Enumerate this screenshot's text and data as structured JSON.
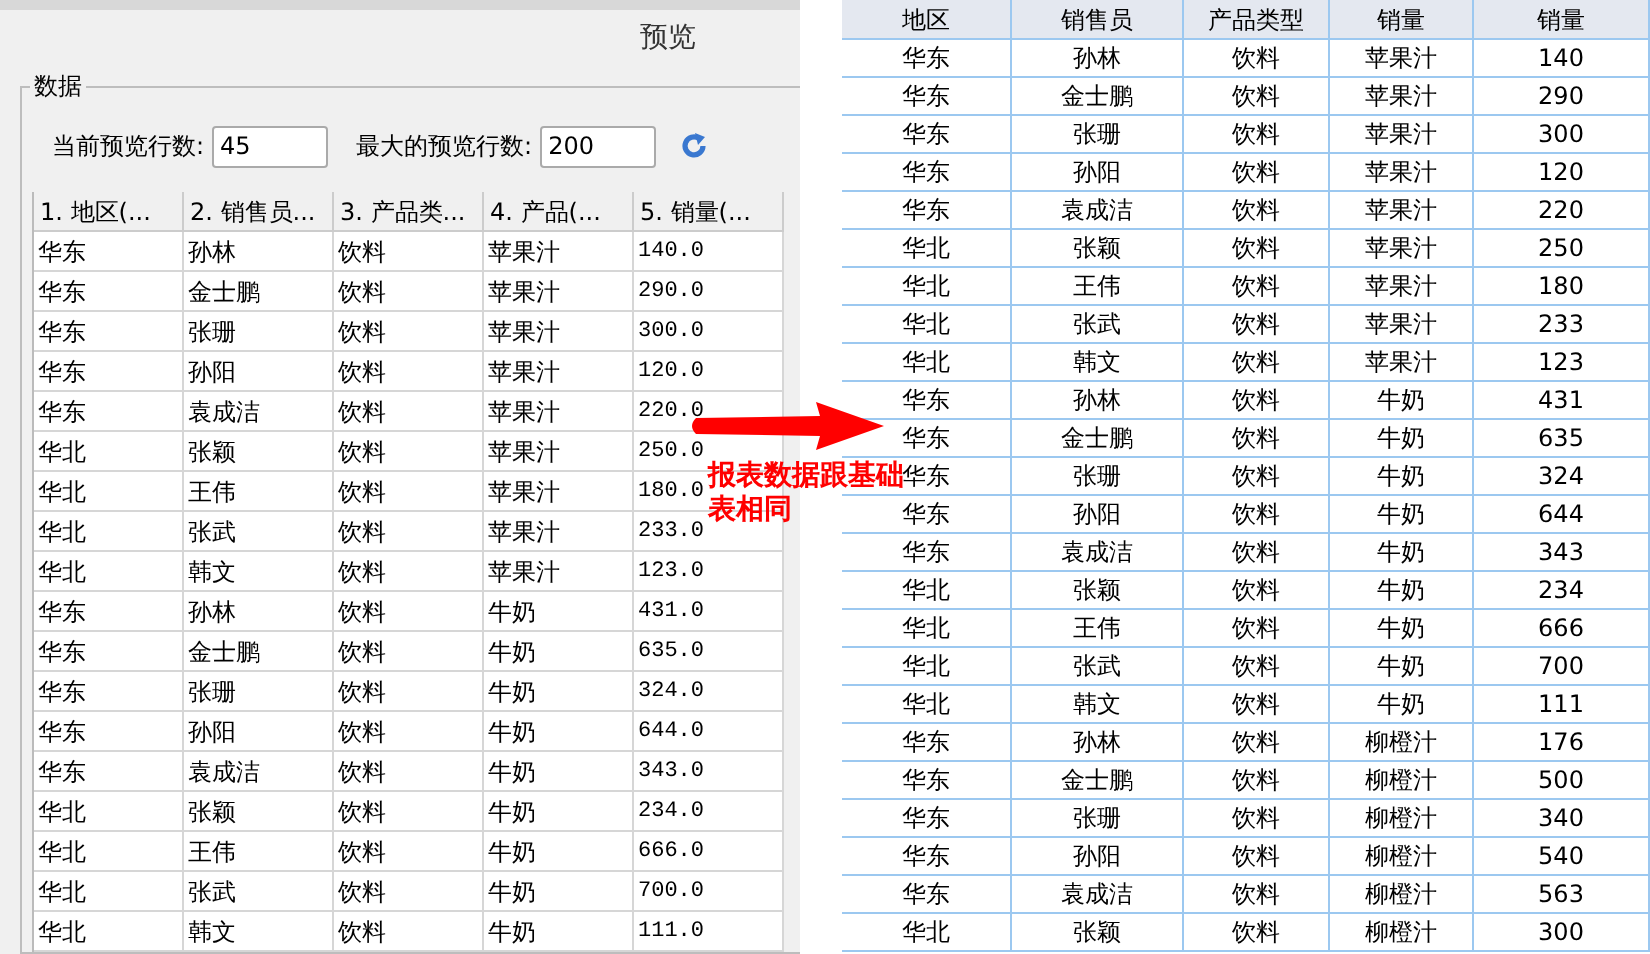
{
  "preview": {
    "title": "预览",
    "group_label": "数据",
    "current_rows": {
      "label": "当前预览行数:",
      "value": "45"
    },
    "max_rows": {
      "label": "最大的预览行数:",
      "value": "200"
    },
    "columns": [
      "1. 地区(...",
      "2. 销售员...",
      "3. 产品类...",
      "4. 产品(...",
      "5. 销量(..."
    ],
    "rows": [
      [
        "华东",
        "孙林",
        "饮料",
        "苹果汁",
        "140.0"
      ],
      [
        "华东",
        "金士鹏",
        "饮料",
        "苹果汁",
        "290.0"
      ],
      [
        "华东",
        "张珊",
        "饮料",
        "苹果汁",
        "300.0"
      ],
      [
        "华东",
        "孙阳",
        "饮料",
        "苹果汁",
        "120.0"
      ],
      [
        "华东",
        "袁成洁",
        "饮料",
        "苹果汁",
        "220.0"
      ],
      [
        "华北",
        "张颖",
        "饮料",
        "苹果汁",
        "250.0"
      ],
      [
        "华北",
        "王伟",
        "饮料",
        "苹果汁",
        "180.0"
      ],
      [
        "华北",
        "张武",
        "饮料",
        "苹果汁",
        "233.0"
      ],
      [
        "华北",
        "韩文",
        "饮料",
        "苹果汁",
        "123.0"
      ],
      [
        "华东",
        "孙林",
        "饮料",
        "牛奶",
        "431.0"
      ],
      [
        "华东",
        "金士鹏",
        "饮料",
        "牛奶",
        "635.0"
      ],
      [
        "华东",
        "张珊",
        "饮料",
        "牛奶",
        "324.0"
      ],
      [
        "华东",
        "孙阳",
        "饮料",
        "牛奶",
        "644.0"
      ],
      [
        "华东",
        "袁成洁",
        "饮料",
        "牛奶",
        "343.0"
      ],
      [
        "华北",
        "张颖",
        "饮料",
        "牛奶",
        "234.0"
      ],
      [
        "华北",
        "王伟",
        "饮料",
        "牛奶",
        "666.0"
      ],
      [
        "华北",
        "张武",
        "饮料",
        "牛奶",
        "700.0"
      ],
      [
        "华北",
        "韩文",
        "饮料",
        "牛奶",
        "111.0"
      ]
    ]
  },
  "annotation": "报表数据跟基础表相同",
  "report": {
    "columns": [
      "地区",
      "销售员",
      "产品类型",
      "销量",
      "销量"
    ],
    "rows": [
      [
        "华东",
        "孙林",
        "饮料",
        "苹果汁",
        "140"
      ],
      [
        "华东",
        "金士鹏",
        "饮料",
        "苹果汁",
        "290"
      ],
      [
        "华东",
        "张珊",
        "饮料",
        "苹果汁",
        "300"
      ],
      [
        "华东",
        "孙阳",
        "饮料",
        "苹果汁",
        "120"
      ],
      [
        "华东",
        "袁成洁",
        "饮料",
        "苹果汁",
        "220"
      ],
      [
        "华北",
        "张颖",
        "饮料",
        "苹果汁",
        "250"
      ],
      [
        "华北",
        "王伟",
        "饮料",
        "苹果汁",
        "180"
      ],
      [
        "华北",
        "张武",
        "饮料",
        "苹果汁",
        "233"
      ],
      [
        "华北",
        "韩文",
        "饮料",
        "苹果汁",
        "123"
      ],
      [
        "华东",
        "孙林",
        "饮料",
        "牛奶",
        "431"
      ],
      [
        "华东",
        "金士鹏",
        "饮料",
        "牛奶",
        "635"
      ],
      [
        "华东",
        "张珊",
        "饮料",
        "牛奶",
        "324"
      ],
      [
        "华东",
        "孙阳",
        "饮料",
        "牛奶",
        "644"
      ],
      [
        "华东",
        "袁成洁",
        "饮料",
        "牛奶",
        "343"
      ],
      [
        "华北",
        "张颖",
        "饮料",
        "牛奶",
        "234"
      ],
      [
        "华北",
        "王伟",
        "饮料",
        "牛奶",
        "666"
      ],
      [
        "华北",
        "张武",
        "饮料",
        "牛奶",
        "700"
      ],
      [
        "华北",
        "韩文",
        "饮料",
        "牛奶",
        "111"
      ],
      [
        "华东",
        "孙林",
        "饮料",
        "柳橙汁",
        "176"
      ],
      [
        "华东",
        "金士鹏",
        "饮料",
        "柳橙汁",
        "500"
      ],
      [
        "华东",
        "张珊",
        "饮料",
        "柳橙汁",
        "340"
      ],
      [
        "华东",
        "孙阳",
        "饮料",
        "柳橙汁",
        "540"
      ],
      [
        "华东",
        "袁成洁",
        "饮料",
        "柳橙汁",
        "563"
      ],
      [
        "华北",
        "张颖",
        "饮料",
        "柳橙汁",
        "300"
      ]
    ]
  }
}
